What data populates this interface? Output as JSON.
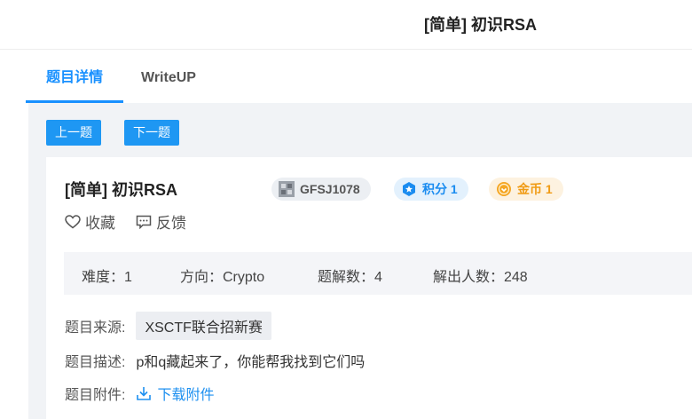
{
  "header": {
    "title": "[简单] 初识RSA"
  },
  "tabs": [
    {
      "label": "题目详情"
    },
    {
      "label": "WriteUP"
    }
  ],
  "nav": {
    "prev_label": "上一题",
    "next_label": "下一题"
  },
  "problem": {
    "title": "[简单] 初识RSA",
    "id_badge": "GFSJ1078",
    "score_badge": "积分 1",
    "coin_badge": "金币 1",
    "favorite_label": "收藏",
    "feedback_label": "反馈"
  },
  "stats": {
    "difficulty": "难度：1",
    "direction": "方向：Crypto",
    "solves": "题解数：4",
    "solvers": "解出人数：248"
  },
  "info": {
    "source_label": "题目来源:",
    "source_value": "XSCTF联合招新赛",
    "desc_label": "题目描述:",
    "desc_value": "p和q藏起来了，你能帮我找到它们吗",
    "attach_label": "题目附件:",
    "attach_link": "下载附件"
  },
  "colors": {
    "accent": "#1890ff",
    "button": "#1e97f3",
    "coin": "#f09b14"
  },
  "icons": [
    "avatar-icon",
    "score-icon",
    "coin-icon",
    "heart-icon",
    "feedback-icon",
    "download-icon"
  ]
}
